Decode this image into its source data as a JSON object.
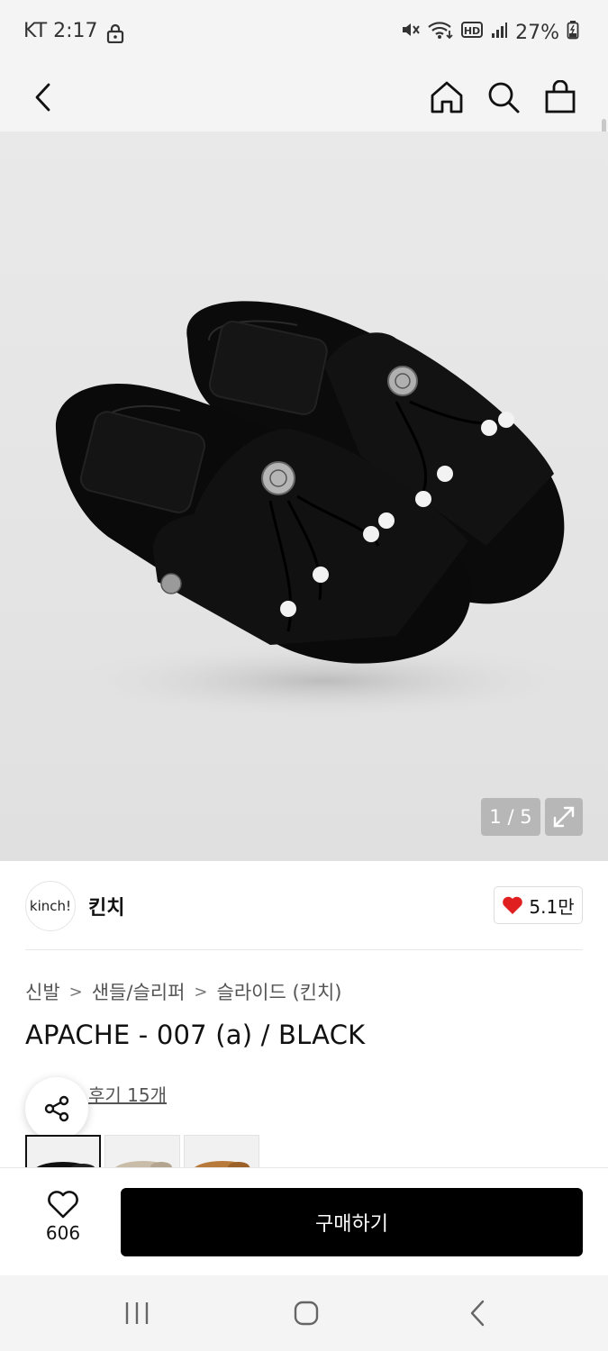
{
  "status_bar": {
    "time": "KT 2:17",
    "battery": "27%",
    "icons": [
      "lock-icon",
      "mute-icon",
      "wifi-icon",
      "hd-icon",
      "signal-icon",
      "battery-icon"
    ]
  },
  "top_nav": {
    "icons": [
      "back-icon",
      "home-icon",
      "search-icon",
      "shopping-bag-icon"
    ]
  },
  "gallery": {
    "counter": "1 / 5",
    "icons": [
      "expand-icon"
    ]
  },
  "brand": {
    "logo_text": "kinch!",
    "name": "킨치",
    "likes": "5.1만"
  },
  "breadcrumb": {
    "items": [
      "신발",
      "샌들/슬리퍼",
      "슬라이드 (킨치)"
    ],
    "separator": ">"
  },
  "product": {
    "title": "APACHE - 007 (a) / BLACK",
    "reviews_link": "후기 15개"
  },
  "bottom_bar": {
    "wish_count": "606",
    "buy_label": "구매하기"
  },
  "colors": {
    "accent_heart": "#e02020",
    "buy_button": "#000000"
  }
}
